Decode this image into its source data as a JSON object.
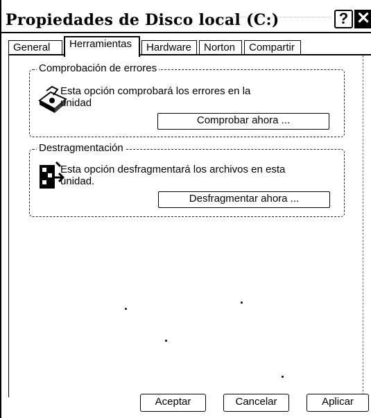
{
  "window": {
    "title": "Propiedades de Disco local (C:)",
    "help_label": "?",
    "close_label": "✕"
  },
  "tabs": [
    {
      "label": "General",
      "active": false
    },
    {
      "label": "Herramientas",
      "active": true
    },
    {
      "label": "Hardware",
      "active": false
    },
    {
      "label": "Norton",
      "active": false
    },
    {
      "label": "Compartir",
      "active": false
    }
  ],
  "error_check": {
    "legend": "Comprobación de errores",
    "description": "Esta opción comprobará los errores en la unidad",
    "button_label": "Comprobar ahora ...",
    "icon": "disk-check-icon"
  },
  "defrag": {
    "legend": "Destragmentación",
    "description": "Esta opción desfragmentará los archivos en esta unidad.",
    "button_label": "Desfragmentar ahora ...",
    "icon": "defrag-icon"
  },
  "buttons": {
    "ok": "Aceptar",
    "cancel": "Cancelar",
    "apply": "Aplicar"
  }
}
